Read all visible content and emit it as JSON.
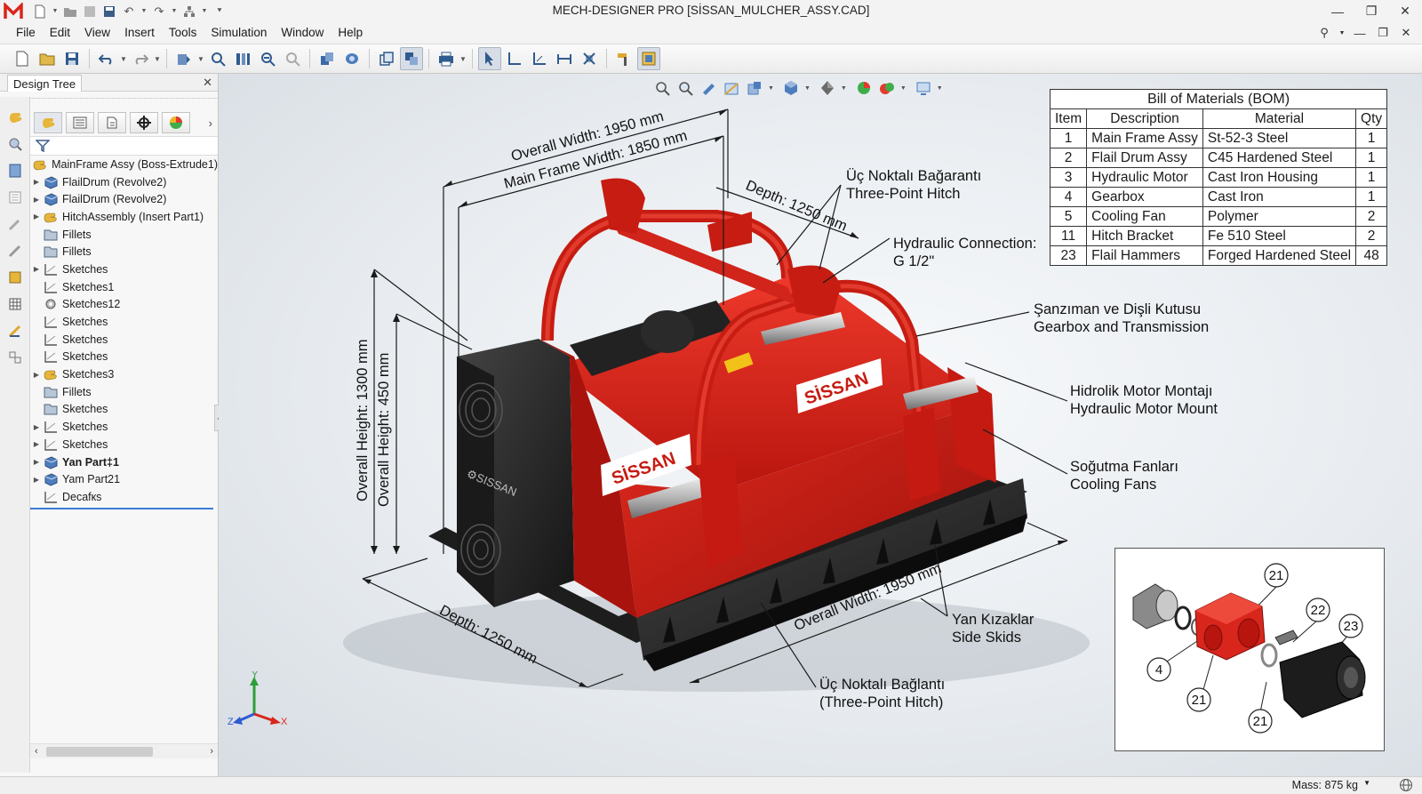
{
  "window": {
    "title": "MECH-DESIGNER PRO  [SİSSAN_MULCHER_ASSY.CAD]",
    "brand_color": "#d9261c"
  },
  "menu": [
    "File",
    "Edit",
    "View",
    "Insert",
    "Tools",
    "Simulation",
    "Window",
    "Help"
  ],
  "design_tree": {
    "tab_label": "Design Tree",
    "items": [
      {
        "label": "MainFrame Assy (Boss-Extrude1)",
        "icon": "assembly-icon",
        "expand": ""
      },
      {
        "label": "FlailDrum (Revolve2)",
        "icon": "part-icon",
        "expand": "▶"
      },
      {
        "label": "FlailDrum (Revolve2)",
        "icon": "part-icon",
        "expand": "▶"
      },
      {
        "label": "HitchAssembly (Insert Part1)",
        "icon": "assembly-icon",
        "expand": "▶"
      },
      {
        "label": "Fillets",
        "icon": "folder-icon",
        "expand": ""
      },
      {
        "label": "Fillets",
        "icon": "folder-icon",
        "expand": ""
      },
      {
        "label": "Sketches",
        "icon": "sketch-icon",
        "expand": "▶"
      },
      {
        "label": "Sketches1",
        "icon": "sketch-icon",
        "expand": ""
      },
      {
        "label": "Sketches12",
        "icon": "sketch-gear-icon",
        "expand": ""
      },
      {
        "label": "Sketches",
        "icon": "sketch-icon",
        "expand": ""
      },
      {
        "label": "Sketches",
        "icon": "sketch-icon",
        "expand": ""
      },
      {
        "label": "Sketches",
        "icon": "sketch-icon",
        "expand": ""
      },
      {
        "label": "Sketches3",
        "icon": "assembly-icon",
        "expand": "▶"
      },
      {
        "label": "Fillets",
        "icon": "folder-icon",
        "expand": ""
      },
      {
        "label": "Sketches",
        "icon": "folder-icon",
        "expand": ""
      },
      {
        "label": "Sketches",
        "icon": "sketch-icon",
        "expand": "▶"
      },
      {
        "label": "Sketches",
        "icon": "sketch-icon",
        "expand": "▶"
      },
      {
        "label": "Yan Part‡1",
        "icon": "part-icon",
        "expand": "▶",
        "bold": true
      },
      {
        "label": "Yam Part21",
        "icon": "part-icon",
        "expand": "▶"
      },
      {
        "label": "Decafкs",
        "icon": "sketch-icon",
        "expand": ""
      }
    ]
  },
  "bom": {
    "title": "Bill of Materials (BOM)",
    "columns": [
      "Item",
      "Description",
      "Material",
      "Qty"
    ],
    "rows": [
      [
        "1",
        "Main Frame Assy",
        "St-52-3 Steel",
        "1"
      ],
      [
        "2",
        "Flail Drum Assy",
        "C45 Hardened Steel",
        "1"
      ],
      [
        "3",
        "Hydraulic Motor",
        "Cast Iron Housing",
        "1"
      ],
      [
        "4",
        "Gearbox",
        "Cast Iron",
        "1"
      ],
      [
        "5",
        "Cooling Fan",
        "Polymer",
        "2"
      ],
      [
        "11",
        "Hitch Bracket",
        "Fe 510 Steel",
        "2"
      ],
      [
        "23",
        "Flail Hammers",
        "Forged Hardened Steel",
        "48"
      ]
    ]
  },
  "dimensions": {
    "overall_width_top": "Overall Width: 1950 mm",
    "main_frame_width": "Main Frame Width: 1850 mm",
    "depth_top": "Depth: 1250 mm",
    "overall_height_1300": "Overall Height: 1300 mm",
    "overall_height_450": "Overall Height: 450 mm",
    "depth_bottom": "Depth: 1250 mm",
    "overall_width_bottom": "Overall Width: 1950 mm"
  },
  "annotations": {
    "hitch_top": [
      "Üç Noktalı Bağarantı",
      "Three-Point Hitch"
    ],
    "hydraulic_conn": [
      "Hydraulic Connection:",
      "G 1/2\""
    ],
    "gearbox": [
      "Şanzıman ve Dişli Kutusu",
      "Gearbox and Transmission"
    ],
    "motor_mount": [
      "Hidrolik Motor Montajı",
      "Hydraulic Motor Mount"
    ],
    "fans": [
      "Soğutma Fanları",
      "Cooling Fans"
    ],
    "skids": [
      "Yan Kızaklar",
      "Side Skids"
    ],
    "hitch_bottom": [
      "Üç Noktalı Bağlantı",
      "(Three-Point Hitch)"
    ]
  },
  "brand_text": "SİSSAN",
  "detail_balloons": [
    "21",
    "22",
    "23",
    "4",
    "21",
    "21"
  ],
  "triad": {
    "x": "X",
    "y": "Y",
    "z": "Z"
  },
  "status": {
    "mass": "Mass: 875 kg"
  }
}
